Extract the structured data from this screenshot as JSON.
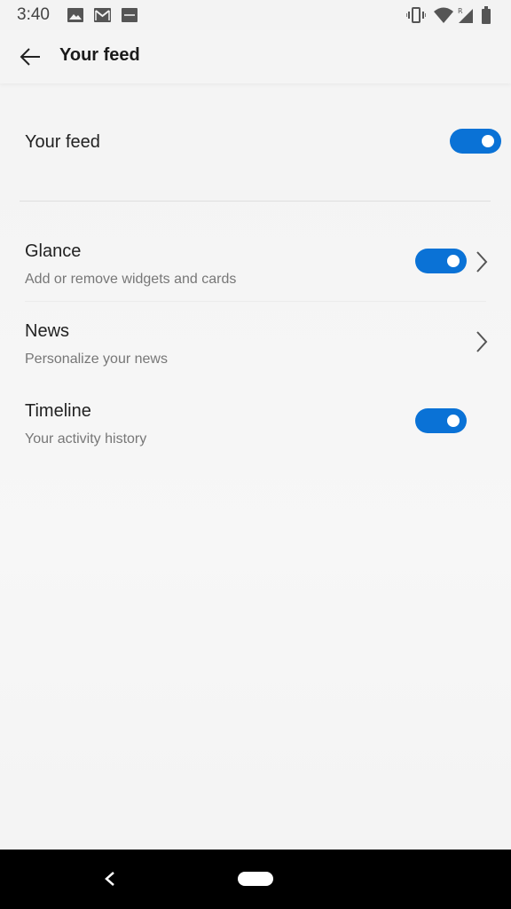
{
  "status_bar": {
    "time": "3:40",
    "left_icons": [
      "image-icon",
      "gmail-icon",
      "sonos-icon"
    ],
    "right_icons": [
      "vibrate-icon",
      "wifi-icon",
      "signal-icon",
      "battery-icon"
    ]
  },
  "app_bar": {
    "title": "Your feed",
    "back_icon": "arrow-left-icon"
  },
  "master": {
    "label": "Your feed",
    "enabled": true
  },
  "settings": [
    {
      "title": "Glance",
      "subtitle": "Add or remove widgets and cards",
      "toggle": true,
      "chevron": true
    },
    {
      "title": "News",
      "subtitle": "Personalize your news",
      "toggle": false,
      "chevron": true
    },
    {
      "title": "Timeline",
      "subtitle": "Your activity history",
      "toggle": true,
      "chevron": false
    }
  ],
  "colors": {
    "accent": "#0a72d6",
    "background": "#f5f5f5",
    "nav_bar": "#000000"
  }
}
